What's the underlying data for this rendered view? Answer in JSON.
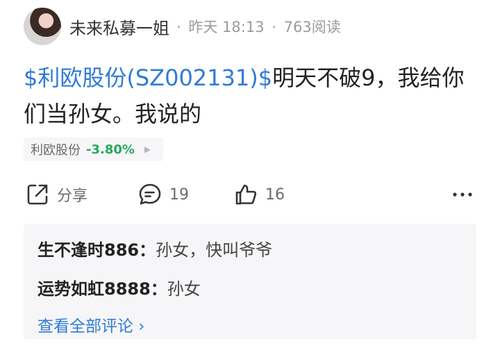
{
  "post": {
    "author": "未来私募一姐",
    "time": "昨天 18:13",
    "views": "763阅读",
    "stock_link": "$利欧股份(SZ002131)$",
    "text": "明天不破9，我给你们当孙女。我说的"
  },
  "stock_chip": {
    "name": "利欧股份",
    "change": "-3.80%"
  },
  "actions": {
    "share_label": "分享",
    "comment_count": "19",
    "like_count": "16"
  },
  "comments": [
    {
      "user": "生不逢时886：",
      "text": "孙女，快叫爷爷"
    },
    {
      "user": "运势如虹8888：",
      "text": "孙女"
    }
  ],
  "view_all": "查看全部评论 ›",
  "colors": {
    "link": "#2f7bd7",
    "down": "#27a85c",
    "muted": "#9a9a9a",
    "panel": "#f6f6f8"
  }
}
